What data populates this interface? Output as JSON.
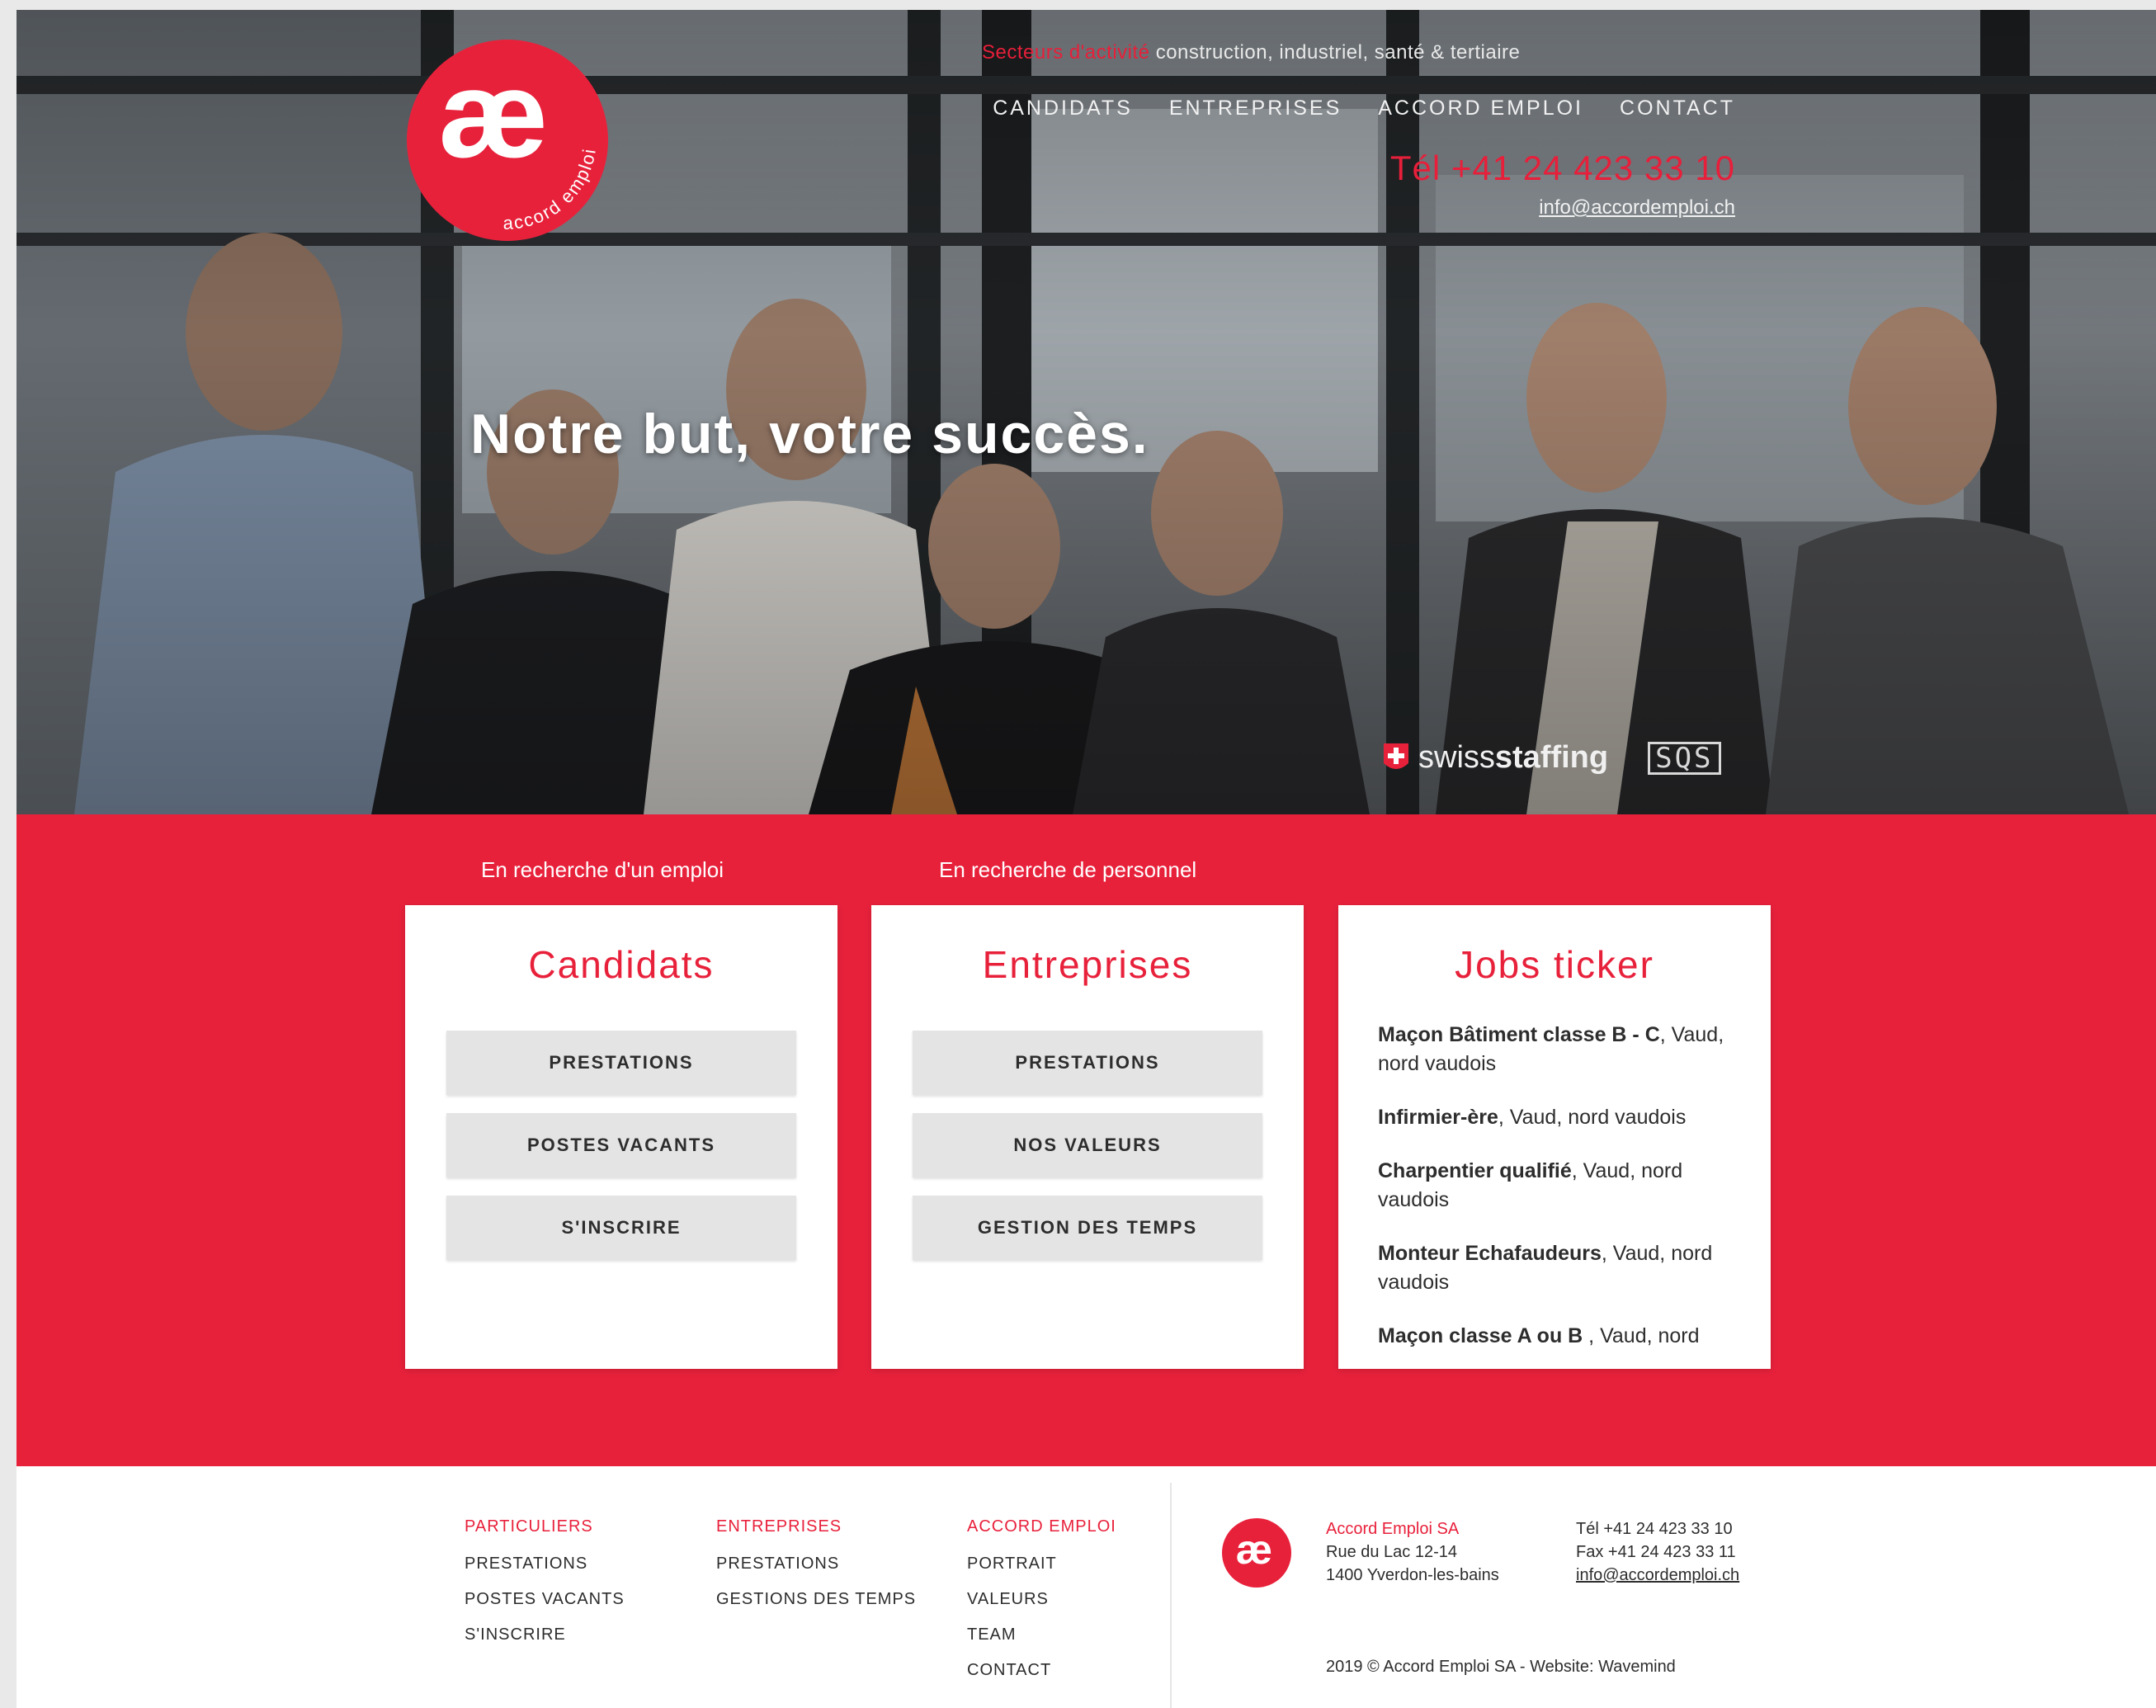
{
  "brand": {
    "logo_glyph": "æ",
    "logo_arc_text": "accord emploi",
    "accent_color": "#e8213b"
  },
  "header": {
    "sectors_label": "Secteurs d'activité",
    "sectors_text": "construction, industriel, santé & tertiaire",
    "nav": [
      "CANDIDATS",
      "ENTREPRISES",
      "ACCORD EMPLOI",
      "CONTACT"
    ],
    "phone": "Tél +41 24 423 33 10",
    "email": "info@accordemploi.ch"
  },
  "hero": {
    "headline": "Notre but, votre succès.",
    "cert_swiss_light": "swiss",
    "cert_swiss_bold": "staffing",
    "cert_sqs": "SQS"
  },
  "band": {
    "label_candidates": "En recherche d'un emploi",
    "label_companies": "En recherche de personnel",
    "candidates": {
      "title": "Candidats",
      "buttons": [
        "PRESTATIONS",
        "POSTES VACANTS",
        "S'INSCRIRE"
      ]
    },
    "companies": {
      "title": "Entreprises",
      "buttons": [
        "PRESTATIONS",
        "NOS VALEURS",
        "GESTION DES TEMPS"
      ]
    },
    "jobs": {
      "title": "Jobs ticker",
      "items": [
        {
          "job": "Maçon Bâtiment classe B - C",
          "loc": ", Vaud, nord vaudois"
        },
        {
          "job": "Infirmier-ère",
          "loc": ", Vaud, nord vaudois"
        },
        {
          "job": "Charpentier qualifié",
          "loc": ", Vaud, nord vaudois"
        },
        {
          "job": "Monteur Echafaudeurs",
          "loc": ", Vaud, nord vaudois"
        },
        {
          "job": "Maçon classe A ou B ",
          "loc": ", Vaud, nord"
        }
      ]
    }
  },
  "footer": {
    "col1": {
      "heading": "PARTICULIERS",
      "links": [
        "PRESTATIONS",
        "POSTES VACANTS",
        "S'INSCRIRE"
      ]
    },
    "col2": {
      "heading": "ENTREPRISES",
      "links": [
        "PRESTATIONS",
        "GESTIONS DES TEMPS"
      ]
    },
    "col3": {
      "heading": "ACCORD EMPLOI",
      "links": [
        "PORTRAIT",
        "VALEURS",
        "TEAM",
        "CONTACT"
      ]
    },
    "company_name": "Accord Emploi SA",
    "address_line1": "Rue du Lac 12-14",
    "address_line2": "1400 Yverdon-les-bains",
    "tel": "Tél +41 24 423 33 10",
    "fax": "Fax +41 24 423 33 11",
    "email": "info@accordemploi.ch",
    "copyright": "2019 © Accord Emploi SA - Website: Wavemind"
  }
}
